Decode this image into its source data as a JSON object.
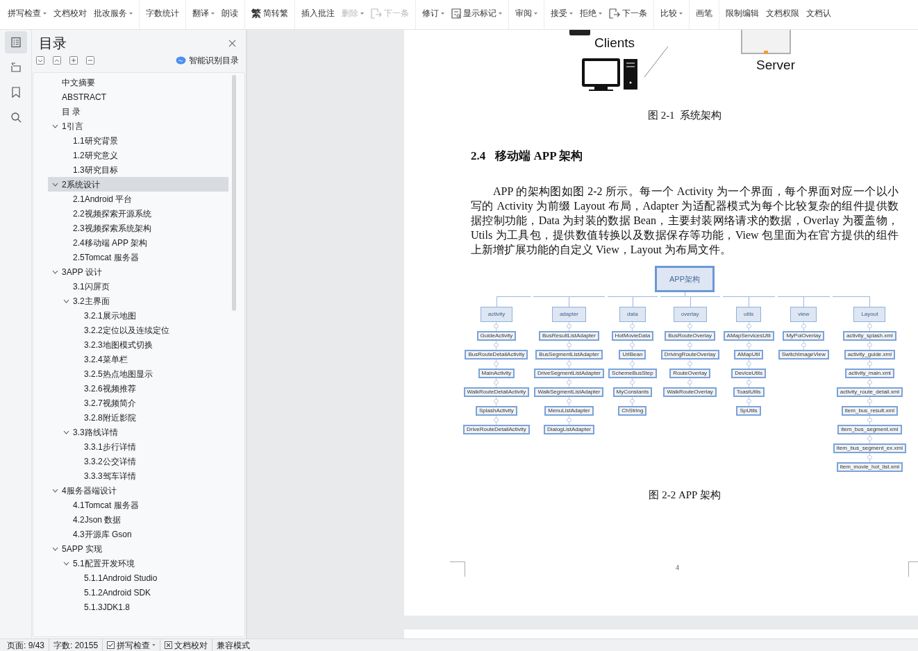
{
  "toolbar": {
    "groups": [
      [
        {
          "label": "拼写检查",
          "kind": "text",
          "dropdown": true,
          "disabled": false
        },
        {
          "label": "文档校对",
          "kind": "text",
          "dropdown": false,
          "disabled": false
        },
        {
          "label": "批改服务",
          "kind": "text",
          "dropdown": true,
          "disabled": false
        }
      ],
      [
        {
          "label": "字数统计",
          "kind": "text",
          "dropdown": false,
          "disabled": false
        }
      ],
      [
        {
          "label": "翻译",
          "kind": "text",
          "dropdown": true,
          "disabled": false
        },
        {
          "label": "朗读",
          "kind": "text",
          "dropdown": false,
          "disabled": false
        }
      ],
      [
        {
          "label": "简转繁",
          "kind": "glyph",
          "glyph": "繁",
          "dropdown": false,
          "disabled": false
        }
      ],
      [
        {
          "label": "插入批注",
          "kind": "text",
          "dropdown": false,
          "disabled": false
        },
        {
          "label": "删除",
          "kind": "text",
          "dropdown": true,
          "disabled": true
        },
        {
          "label": "下一条",
          "kind": "next",
          "dropdown": false,
          "disabled": true
        }
      ],
      [
        {
          "label": "修订",
          "kind": "text",
          "dropdown": true,
          "disabled": false
        },
        {
          "label": "显示标记",
          "kind": "markup",
          "dropdown": true,
          "disabled": false
        }
      ],
      [
        {
          "label": "审阅",
          "kind": "text",
          "dropdown": true,
          "disabled": false
        }
      ],
      [
        {
          "label": "接受",
          "kind": "text",
          "dropdown": true,
          "disabled": false
        },
        {
          "label": "拒绝",
          "kind": "text",
          "dropdown": true,
          "disabled": false
        },
        {
          "label": "下一条",
          "kind": "next",
          "dropdown": false,
          "disabled": false
        }
      ],
      [
        {
          "label": "比较",
          "kind": "text",
          "dropdown": true,
          "disabled": false
        }
      ],
      [
        {
          "label": "画笔",
          "kind": "text",
          "dropdown": false,
          "disabled": false
        }
      ],
      [
        {
          "label": "限制编辑",
          "kind": "text",
          "dropdown": false,
          "disabled": false
        },
        {
          "label": "文档权限",
          "kind": "text",
          "dropdown": false,
          "disabled": false
        },
        {
          "label": "文档认",
          "kind": "text",
          "dropdown": false,
          "disabled": false
        }
      ]
    ]
  },
  "nav_rail": [
    {
      "kind": "outline",
      "selected": true
    },
    {
      "kind": "structure",
      "selected": false
    },
    {
      "kind": "bookmark",
      "selected": false
    },
    {
      "kind": "search",
      "selected": false
    }
  ],
  "toc_panel": {
    "title": "目录",
    "tools": [
      {
        "kind": "down"
      },
      {
        "kind": "up"
      },
      {
        "kind": "plus"
      },
      {
        "kind": "minus"
      }
    ],
    "smart_button": "智能识别目录",
    "items": [
      {
        "label": "中文摘要",
        "selected": false
      },
      {
        "label": "ABSTRACT",
        "selected": false
      },
      {
        "label": "目 录",
        "selected": false
      },
      {
        "label": "1引言",
        "selected": false,
        "expanded": true,
        "children": [
          {
            "label": "1.1研究背景",
            "selected": false
          },
          {
            "label": "1.2研究意义",
            "selected": false
          },
          {
            "label": "1.3研究目标",
            "selected": false
          }
        ]
      },
      {
        "label": "2系统设计",
        "selected": true,
        "expanded": true,
        "children": [
          {
            "label": "2.1Android 平台",
            "selected": false
          },
          {
            "label": "2.2视频探索开源系统",
            "selected": false
          },
          {
            "label": "2.3视频探索系统架构",
            "selected": false
          },
          {
            "label": "2.4移动端 APP 架构",
            "selected": false
          },
          {
            "label": "2.5Tomcat 服务器",
            "selected": false
          }
        ]
      },
      {
        "label": "3APP 设计",
        "selected": false,
        "expanded": true,
        "children": [
          {
            "label": "3.1闪屏页",
            "selected": false
          },
          {
            "label": "3.2主界面",
            "selected": false,
            "expanded": true,
            "children": [
              {
                "label": "3.2.1展示地图",
                "selected": false
              },
              {
                "label": "3.2.2定位以及连续定位",
                "selected": false
              },
              {
                "label": "3.2.3地图模式切换",
                "selected": false
              },
              {
                "label": "3.2.4菜单栏",
                "selected": false
              },
              {
                "label": "3.2.5热点地图显示",
                "selected": false
              },
              {
                "label": "3.2.6视频推荐",
                "selected": false
              },
              {
                "label": "3.2.7视频简介",
                "selected": false
              },
              {
                "label": "3.2.8附近影院",
                "selected": false
              }
            ]
          },
          {
            "label": "3.3路线详情",
            "selected": false,
            "expanded": true,
            "children": [
              {
                "label": "3.3.1步行详情",
                "selected": false
              },
              {
                "label": "3.3.2公交详情",
                "selected": false
              },
              {
                "label": "3.3.3驾车详情",
                "selected": false
              }
            ]
          }
        ]
      },
      {
        "label": "4服务器端设计",
        "selected": false,
        "expanded": true,
        "children": [
          {
            "label": "4.1Tomcat 服务器",
            "selected": false
          },
          {
            "label": "4.2Json 数据",
            "selected": false
          },
          {
            "label": "4.3开源库 Gson",
            "selected": false
          }
        ]
      },
      {
        "label": "5APP 实现",
        "selected": false,
        "expanded": true,
        "children": [
          {
            "label": "5.1配置开发环境",
            "selected": false,
            "expanded": true,
            "children": [
              {
                "label": "5.1.1Android Studio",
                "selected": false
              },
              {
                "label": "5.1.2Android SDK",
                "selected": false
              },
              {
                "label": "5.1.3JDK1.8",
                "selected": false
              }
            ]
          }
        ]
      }
    ]
  },
  "document": {
    "top_figure": {
      "clients_label": "Clients",
      "server_label": "Server"
    },
    "figure_caption_1": "图 2-1  系统架构",
    "heading": {
      "number": "2.4",
      "title": "移动端 APP 架构"
    },
    "paragraph": "APP 的架构图如图 2-2 所示。每一个 Activity 为一个界面，每个界面对应一个以小写的 Activity 为前缀 Layout 布局，Adapter 为适配器模式为每个比较复杂的组件提供数据控制功能，Data 为封装的数据 Bean，主要封装网络请求的数据，Overlay 为覆盖物，Utils 为工具包，提供数值转换以及数据保存等功能，View 包里面为在官方提供的组件上新增扩展功能的自定义 View，Layout 为布局文件。",
    "diagram": {
      "root": "APP架构",
      "branches": [
        {
          "label": "activity",
          "children": [
            "GuideActivity",
            "BusRouteDetailActivity",
            "MainActivity",
            "WalkRouteDetailActivity",
            "SplashActivity",
            "DriveRouteDetailActivity"
          ]
        },
        {
          "label": "adapter",
          "children": [
            "BusResultListAdapter",
            "BusSegmentListAdapter",
            "DriveSegmentListAdapter",
            "WalkSegmentListAdapter",
            "MenuListAdapter",
            "DialogListAdapter"
          ]
        },
        {
          "label": "data",
          "children": [
            "HotMovieData",
            "UrlBean",
            "SchemeBusStep",
            "MyConstants",
            "ChString"
          ]
        },
        {
          "label": "overlay",
          "children": [
            "BusRouteOverlay",
            "DrivingRouteOverlay",
            "RouteOverlay",
            "WalkRouteOverlay"
          ]
        },
        {
          "label": "utils",
          "children": [
            "AMapServicesUtil",
            "AMapUtil",
            "DeviceUtils",
            "ToastUtils",
            "SpUtils"
          ]
        },
        {
          "label": "view",
          "children": [
            "MyPoiOverlay",
            "SwitchImageView"
          ]
        },
        {
          "label": "Layout",
          "children": [
            "activity_splash.xml",
            "activity_guide.xml",
            "activity_main.xml",
            "activity_route_detail.xml",
            "item_bus_result.xml",
            "item_bus_segment.xml",
            "item_bus_segment_ex.xml",
            "item_movie_hot_list.xml"
          ]
        }
      ]
    },
    "figure_caption_2": "图 2-2 APP 架构",
    "page_number": "4"
  },
  "status_bar": [
    {
      "kind": "text",
      "label": "页面: 9/43"
    },
    {
      "kind": "text",
      "label": "字数: 20155"
    },
    {
      "kind": "toggle",
      "label": "拼写检查",
      "checked": true,
      "dropdown": true
    },
    {
      "kind": "toggle",
      "label": "文档校对",
      "checked": false,
      "dropdown": false
    },
    {
      "kind": "text",
      "label": "兼容模式"
    }
  ]
}
